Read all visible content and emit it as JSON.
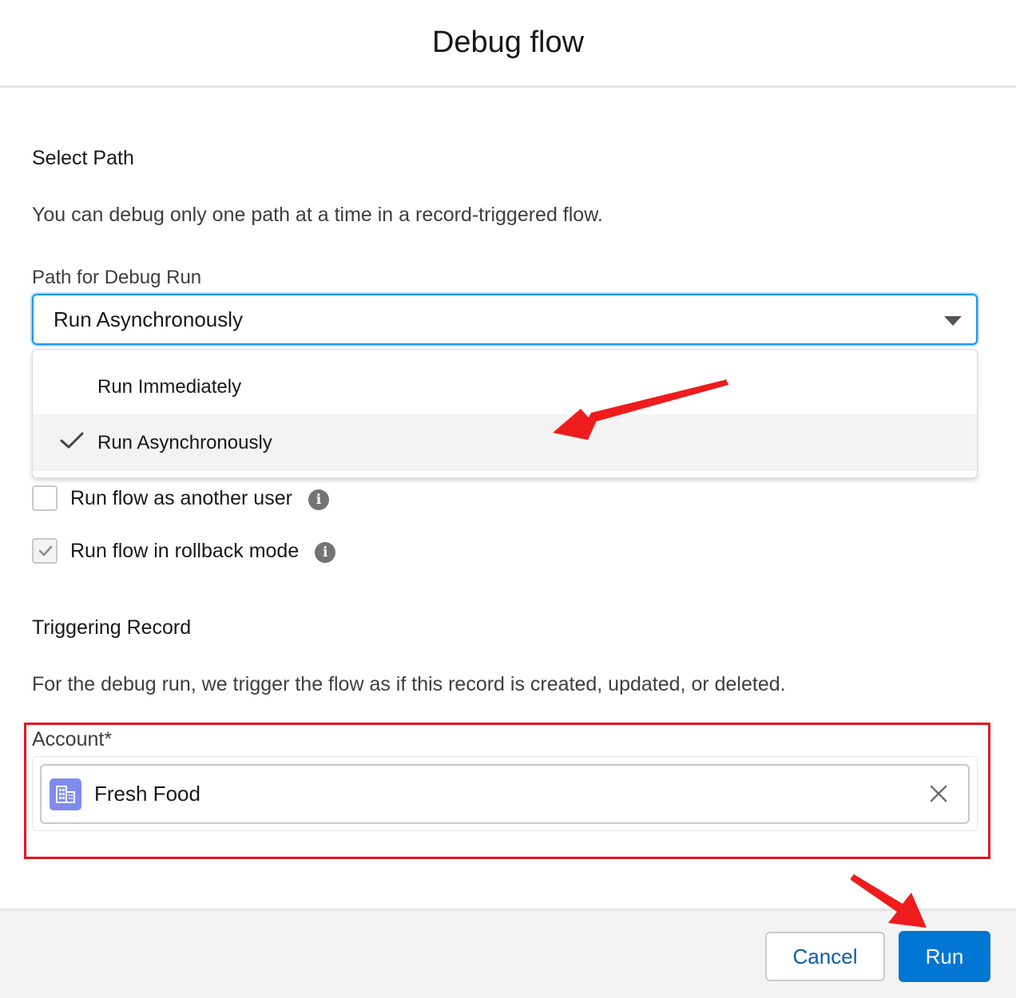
{
  "modal": {
    "title": "Debug flow"
  },
  "select_path": {
    "title": "Select Path",
    "description": "You can debug only one path at a time in a record-triggered flow.",
    "field_label": "Path for Debug Run",
    "selected_value": "Run Asynchronously",
    "options": [
      {
        "label": "Run Immediately",
        "selected": false
      },
      {
        "label": "Run Asynchronously",
        "selected": true
      }
    ]
  },
  "options": {
    "run_as_user": {
      "label": "Run flow as another user",
      "checked": false,
      "info_icon": "info-icon"
    },
    "rollback_mode": {
      "label": "Run flow in rollback mode",
      "checked": true,
      "info_icon": "info-icon"
    }
  },
  "triggering_record": {
    "title": "Triggering Record",
    "description": "For the debug run, we trigger the flow as if this record is created, updated, or deleted.",
    "account_label": "Account*",
    "account_value": "Fresh Food",
    "account_icon": "account-icon"
  },
  "footer": {
    "cancel_label": "Cancel",
    "run_label": "Run"
  },
  "colors": {
    "brand": "#0176d3",
    "focus": "#1b96ff",
    "annotation": "#e5141f",
    "account_icon_bg": "#7f8ced"
  }
}
